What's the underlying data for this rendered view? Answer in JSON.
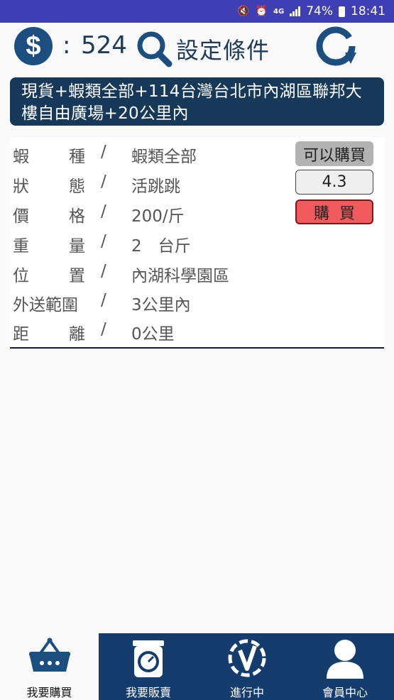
{
  "status_bar": {
    "battery": "74%",
    "time": "18:41",
    "network": "4G"
  },
  "top": {
    "currency_symbol": "$",
    "colon": ":",
    "balance": "524",
    "settings_label": "設定條件"
  },
  "banner": {
    "line1": "現貨+蝦類全部+114台灣台北市內湖區聯邦大",
    "line2": "樓自由廣場+20公里內"
  },
  "listing": {
    "separator": "/",
    "rows": [
      {
        "label_a": "蝦",
        "label_b": "種",
        "value": "蝦類全部"
      },
      {
        "label_a": "狀",
        "label_b": "態",
        "value": "活跳跳"
      },
      {
        "label_a": "價",
        "label_b": "格",
        "value": "200/斤"
      },
      {
        "label_a": "重",
        "label_b": "量",
        "value": "2　台斤"
      },
      {
        "label_a": "位",
        "label_b": "置",
        "value": "內湖科學園區"
      },
      {
        "label_full": "外送範圍",
        "value": "3公里內"
      },
      {
        "label_a": "距",
        "label_b": "離",
        "value": "0公里"
      }
    ],
    "can_buy_label": "可以購買",
    "rating": "4.3",
    "buy_label": "購買"
  },
  "nav": [
    {
      "label": "我要購買",
      "icon": "basket-icon",
      "active": true
    },
    {
      "label": "我要販賣",
      "icon": "scale-icon",
      "active": false
    },
    {
      "label": "進行中",
      "icon": "in-progress-icon",
      "active": false
    },
    {
      "label": "會員中心",
      "icon": "member-icon",
      "active": false
    }
  ],
  "colors": {
    "status_bar": "#3f3fb4",
    "navy": "#163859",
    "nav_bg": "#143d6d",
    "buy_red": "#f25b5b"
  }
}
